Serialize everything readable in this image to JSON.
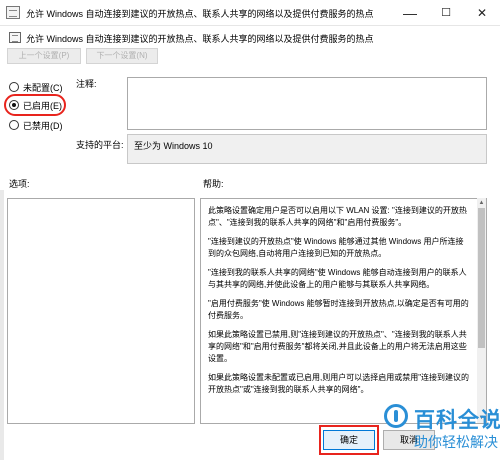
{
  "window": {
    "title": "允许 Windows 自动连接到建议的开放热点、联系人共享的网络以及提供付费服务的热点",
    "minimize": "—",
    "maximize": "☐",
    "close": "✕"
  },
  "policy": {
    "title": "允许 Windows 自动连接到建议的开放热点、联系人共享的网络以及提供付费服务的热点"
  },
  "nav": {
    "prev": "上一个设置(P)",
    "next": "下一个设置(N)"
  },
  "radios": [
    {
      "label": "未配置(C)",
      "selected": false
    },
    {
      "label": "已启用(E)",
      "selected": true
    },
    {
      "label": "已禁用(D)",
      "selected": false
    }
  ],
  "comment": {
    "label": "注释:",
    "value": ""
  },
  "supported": {
    "label": "支持的平台:",
    "value": "至少为 Windows 10"
  },
  "options": {
    "label": "选项:"
  },
  "help": {
    "label": "帮助:",
    "paragraphs": [
      "此策略设置确定用户是否可以启用以下 WLAN 设置: \"连接到建议的开放热点\"、\"连接到我的联系人共享的网络\"和\"启用付费服务\"。",
      "\"连接到建议的开放热点\"使 Windows 能够通过其他 Windows 用户所连接到的众包网络,自动将用户连接到已知的开放热点。",
      "\"连接到我的联系人共享的网络\"使 Windows 能够自动连接到用户的联系人与其共享的网络,并使此设备上的用户能够与其联系人共享网络。",
      "\"启用付费服务\"使 Windows 能够暂时连接到开放热点,以确定是否有可用的付费服务。",
      "如果此策略设置已禁用,则\"连接到建议的开放热点\"、\"连接到我的联系人共享的网络\"和\"启用付费服务\"都将关闭,并且此设备上的用户将无法启用这些设置。",
      "如果此策略设置未配置或已启用,则用户可以选择启用或禁用\"连接到建议的开放热点\"或\"连接到我的联系人共享的网络\"。"
    ]
  },
  "buttons": {
    "ok": "确定",
    "cancel": "取消"
  },
  "watermark": {
    "main": "百科全说",
    "sub": "助你轻松解决"
  },
  "colors": {
    "highlight": "#e8241d",
    "watermark": "#2a8fd6"
  }
}
